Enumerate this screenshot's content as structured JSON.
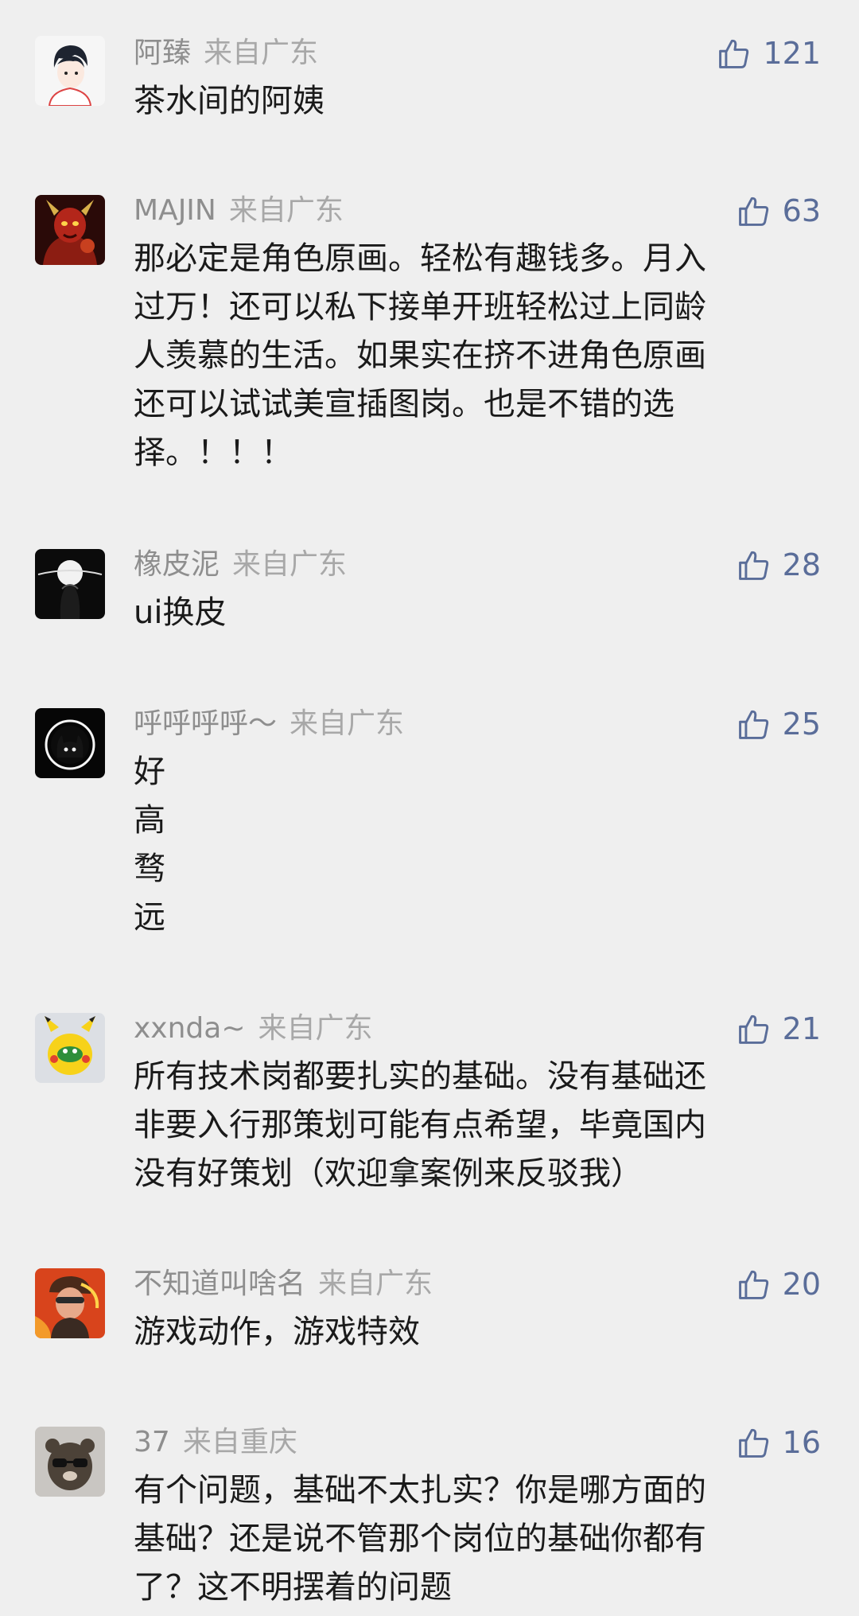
{
  "comments": [
    {
      "username": "阿臻",
      "location": "来自广东",
      "likes": "121",
      "lines": [
        "茶水间的阿姨"
      ]
    },
    {
      "username": "MAJIN",
      "location": "来自广东",
      "likes": "63",
      "lines": [
        "那必定是角色原画。轻松有趣钱多。月入",
        "过万！还可以私下接单开班轻松过上同龄",
        "人羡慕的生活。如果实在挤不进角色原画",
        "还可以试试美宣插图岗。也是不错的选",
        "择。！！！"
      ]
    },
    {
      "username": "橡皮泥",
      "location": "来自广东",
      "likes": "28",
      "lines": [
        "ui换皮"
      ]
    },
    {
      "username": "呼呼呼呼～",
      "location": "来自广东",
      "likes": "25",
      "lines": [
        "好",
        "高",
        "骛",
        "远"
      ]
    },
    {
      "username": "xxnda~",
      "location": "来自广东",
      "likes": "21",
      "lines": [
        "所有技术岗都要扎实的基础。没有基础还",
        "非要入行那策划可能有点希望，毕竟国内",
        "没有好策划（欢迎拿案例来反驳我）"
      ]
    },
    {
      "username": "不知道叫啥名",
      "location": "来自广东",
      "likes": "20",
      "lines": [
        "游戏动作，游戏特效"
      ]
    },
    {
      "username": "37",
      "location": "来自重庆",
      "likes": "16",
      "lines": [
        "有个问题，基础不太扎实？你是哪方面的",
        "基础？还是说不管那个岗位的基础你都有",
        "了？这不明摆着的问题"
      ]
    }
  ],
  "colors": {
    "background": "#efefef",
    "username": "#8e8e8e",
    "location": "#a8a8a8",
    "like_accent": "#5a6d99",
    "text": "#1a1a1a"
  },
  "icons": {
    "like": "thumbs-up-icon",
    "avatar": "user-avatar"
  }
}
